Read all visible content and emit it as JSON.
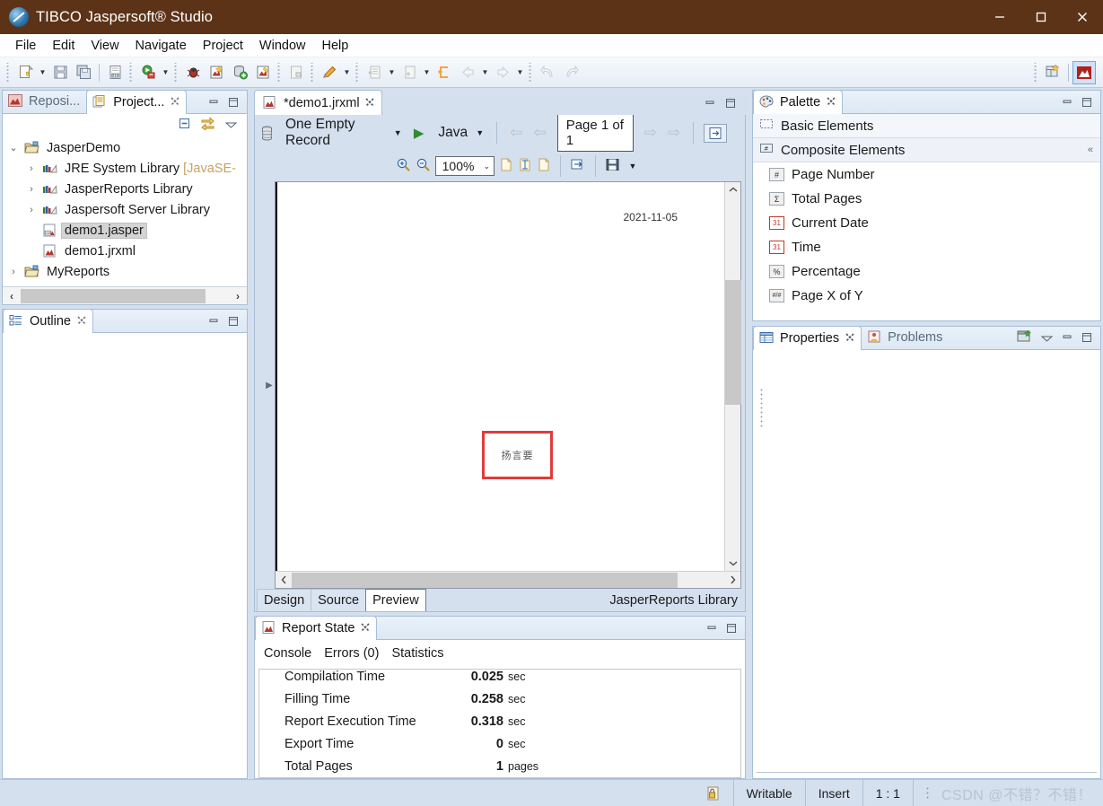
{
  "window": {
    "title": "TIBCO Jaspersoft® Studio",
    "app_icon": "jaspersoft-logo-icon",
    "minimize": "–",
    "maximize": "□",
    "close": "✕",
    "titlebar_color": "#5c3317"
  },
  "menubar": {
    "items": [
      "File",
      "Edit",
      "View",
      "Navigate",
      "Project",
      "Window",
      "Help"
    ]
  },
  "toolbar": {
    "buttons": [
      {
        "name": "new-icon",
        "glyph": "new"
      },
      {
        "name": "new-dropdown-icon",
        "glyph": "▾"
      },
      {
        "name": "save-icon",
        "glyph": "save"
      },
      {
        "name": "save-all-icon",
        "glyph": "save-all"
      },
      {
        "name": "compile-report-icon",
        "glyph": "compile"
      },
      {
        "name": "run-icon",
        "glyph": "run"
      },
      {
        "name": "run-dropdown-icon",
        "glyph": "▾"
      },
      {
        "name": "debug-icon",
        "glyph": "debug"
      },
      {
        "name": "new-report-icon",
        "glyph": "new-report"
      },
      {
        "name": "new-datasource-icon",
        "glyph": "new-datasource"
      },
      {
        "name": "new-jrxml-icon",
        "glyph": "new-jrxml"
      },
      {
        "name": "preview-icon",
        "glyph": "preview"
      },
      {
        "name": "pencil-icon",
        "glyph": "pencil"
      },
      {
        "name": "pencil-dropdown-icon",
        "glyph": "▾"
      },
      {
        "name": "publish-icon",
        "glyph": "publish"
      },
      {
        "name": "publish-dropdown-icon",
        "glyph": "▾"
      },
      {
        "name": "upload-icon",
        "glyph": "upload"
      },
      {
        "name": "upload-dropdown-icon",
        "glyph": "▾"
      },
      {
        "name": "last-edit-icon",
        "glyph": "last-edit"
      },
      {
        "name": "back-icon",
        "glyph": "⇦"
      },
      {
        "name": "back-dropdown-icon",
        "glyph": "▾"
      },
      {
        "name": "forward-icon",
        "glyph": "⇨"
      },
      {
        "name": "forward-dropdown-icon",
        "glyph": "▾"
      },
      {
        "name": "undo-icon",
        "glyph": "undo"
      },
      {
        "name": "redo-icon",
        "glyph": "redo"
      }
    ],
    "right": {
      "open-perspective": "open-perspective-icon",
      "active-perspective": "report-design-perspective-icon"
    }
  },
  "project_explorer": {
    "tabs": [
      {
        "label": "Reposi...",
        "icon": "repository-icon",
        "active": false,
        "closable": false
      },
      {
        "label": "Project...",
        "icon": "project-explorer-icon",
        "active": true,
        "closable": true
      }
    ],
    "view_tools": [
      "collapse-all-icon",
      "link-with-editor-icon",
      "view-menu-icon"
    ],
    "minimize": "minimize-icon",
    "maximize": "maximize-icon",
    "tree": [
      {
        "label": "JasperDemo",
        "icon": "project-folder-icon",
        "indent": 0,
        "twisty": "expanded",
        "selected": false,
        "dim": ""
      },
      {
        "label": "JRE System Library ",
        "dim": "[JavaSE-",
        "icon": "library-icon",
        "indent": 1,
        "twisty": "collapsed",
        "selected": false
      },
      {
        "label": "JasperReports Library",
        "icon": "library-icon",
        "indent": 1,
        "twisty": "collapsed",
        "selected": false,
        "dim": ""
      },
      {
        "label": "Jaspersoft Server Library",
        "icon": "library-icon",
        "indent": 1,
        "twisty": "collapsed",
        "selected": false,
        "dim": ""
      },
      {
        "label": "demo1.jasper",
        "icon": "jasper-file-icon",
        "indent": 1,
        "twisty": "none",
        "selected": true,
        "dim": ""
      },
      {
        "label": "demo1.jrxml",
        "icon": "jrxml-file-icon",
        "indent": 1,
        "twisty": "none",
        "selected": false,
        "dim": ""
      },
      {
        "label": "MyReports",
        "icon": "project-folder-icon",
        "indent": 0,
        "twisty": "collapsed",
        "selected": false,
        "dim": ""
      }
    ],
    "hscroll": {
      "left_arrow": "‹",
      "right_arrow": "›"
    }
  },
  "outline": {
    "tab_label": "Outline",
    "tab_icon": "outline-icon",
    "close": "✕",
    "minimize": "minimize-icon",
    "maximize": "maximize-icon"
  },
  "editor": {
    "tab_label": "*demo1.jrxml",
    "tab_icon": "jrxml-file-icon",
    "tab_close": "✕",
    "minimize": "minimize-icon",
    "maximize": "maximize-icon",
    "preview_toolbar": {
      "datasource_icon": "datasource-icon",
      "datasource": "One Empty Record",
      "datasource_caret": "▼",
      "run_glyph": "▶",
      "language": "Java",
      "language_caret": "▼",
      "first_page": "⇦",
      "prev_page": "⇦",
      "page_indicator": "Page 1 of 1",
      "next_page": "⇨",
      "last_page": "⇨",
      "export_icon": "export-to-icon",
      "zoom_in": "zoom-in-icon",
      "zoom_out": "zoom-out-icon",
      "zoom_level": "100%",
      "zoom_caret": "⌄",
      "actual_size": "actual-size-icon",
      "fit_page": "fit-page-icon",
      "fit_width": "fit-width-icon",
      "export_report": "export-report-icon",
      "save_icon": "save-icon",
      "save_caret": "▼"
    },
    "page": {
      "date_text": "2021-11-05",
      "textfield_value": "扬言要",
      "textfield_border_color": "#e13b3b"
    },
    "bottom_tabs": [
      {
        "label": "Design",
        "active": false
      },
      {
        "label": "Source",
        "active": false
      },
      {
        "label": "Preview",
        "active": true
      }
    ],
    "library_label": "JasperReports Library"
  },
  "report_state": {
    "tab_label": "Report State",
    "tab_icon": "report-state-icon",
    "tab_close": "✕",
    "minimize": "minimize-icon",
    "maximize": "maximize-icon",
    "inner_tabs": [
      "Console",
      "Errors (0)",
      "Statistics"
    ],
    "statistics": [
      {
        "key": "Compilation Time",
        "value": "0.025",
        "unit": "sec"
      },
      {
        "key": "Filling Time",
        "value": "0.258",
        "unit": "sec"
      },
      {
        "key": "Report Execution Time",
        "value": "0.318",
        "unit": "sec"
      },
      {
        "key": "Export Time",
        "value": "0",
        "unit": "sec"
      },
      {
        "key": "Total Pages",
        "value": "1",
        "unit": "pages"
      }
    ]
  },
  "palette": {
    "tab_label": "Palette",
    "tab_icon": "palette-icon",
    "tab_close": "✕",
    "minimize": "minimize-icon",
    "maximize": "maximize-icon",
    "groups": [
      {
        "label": "Basic Elements",
        "icon": "basic-elements-icon",
        "collapse": ""
      },
      {
        "label": "Composite Elements",
        "icon": "composite-elements-icon",
        "collapse": "«"
      }
    ],
    "items": [
      {
        "label": "Page Number",
        "icon": "hash-icon",
        "glyph": "#"
      },
      {
        "label": "Total Pages",
        "icon": "sigma-icon",
        "glyph": "Σ"
      },
      {
        "label": "Current Date",
        "icon": "calendar-icon",
        "glyph": "31"
      },
      {
        "label": "Time",
        "icon": "calendar-icon",
        "glyph": "31"
      },
      {
        "label": "Percentage",
        "icon": "percent-icon",
        "glyph": "%"
      },
      {
        "label": "Page X of Y",
        "icon": "page-x-of-y-icon",
        "glyph": "#/#"
      }
    ]
  },
  "properties": {
    "tabs": [
      {
        "label": "Properties",
        "icon": "properties-icon",
        "active": true,
        "close": "✕"
      },
      {
        "label": "Problems",
        "icon": "problems-icon",
        "active": false,
        "close": ""
      }
    ],
    "tools": [
      "new-property-sheet-icon",
      "view-menu-icon",
      "minimize-icon",
      "maximize-icon"
    ]
  },
  "statusbar": {
    "lock_icon": "writable-lock-icon",
    "writable": "Writable",
    "insert_mode": "Insert",
    "position": "1 : 1",
    "dots_icon": "resize-grip-icon",
    "watermark": "CSDN @不错？不错！"
  }
}
